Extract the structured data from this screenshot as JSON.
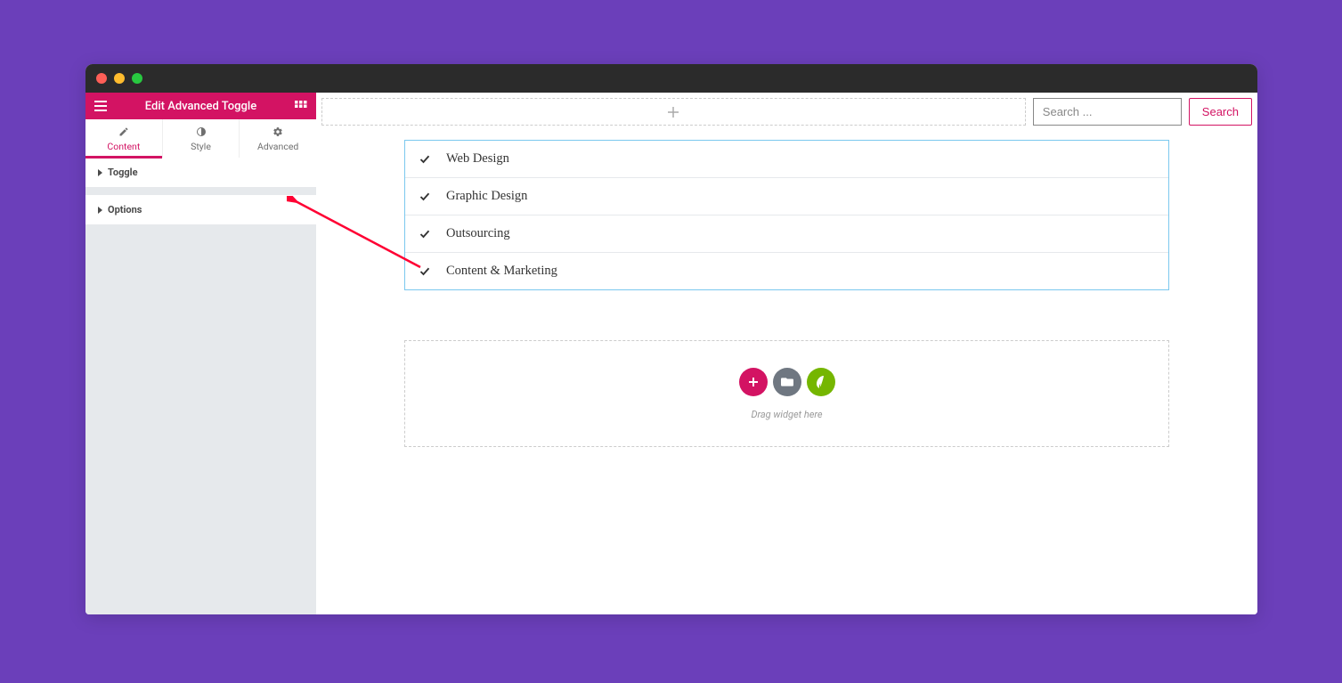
{
  "sidebar": {
    "title": "Edit Advanced Toggle",
    "tabs": {
      "content": "Content",
      "style": "Style",
      "advanced": "Advanced"
    },
    "sections": {
      "toggle": "Toggle",
      "options": "Options"
    }
  },
  "search": {
    "placeholder": "Search ...",
    "button": "Search"
  },
  "toggle_items": [
    "Web Design",
    "Graphic Design",
    "Outsourcing",
    "Content & Marketing"
  ],
  "dropzone": {
    "text": "Drag widget here"
  }
}
